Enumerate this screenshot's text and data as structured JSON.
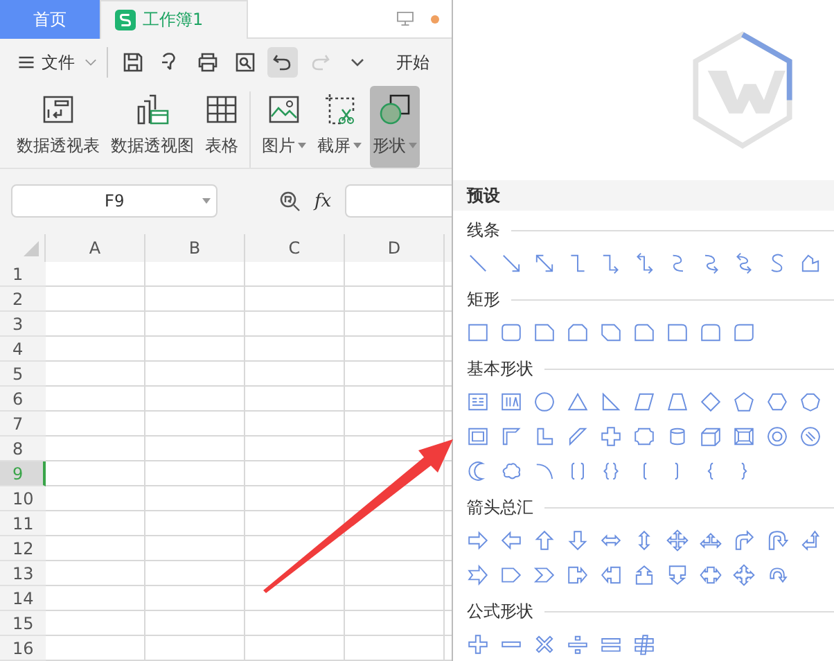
{
  "tabs": [
    {
      "label": "首页",
      "kind": "home",
      "selected": false
    },
    {
      "label": "工作簿1",
      "kind": "doc",
      "selected": true
    }
  ],
  "toolbar": {
    "file_menu": "文件",
    "start_tab": "开始"
  },
  "ribbon": [
    {
      "label": "数据透视表",
      "kind": "pivot-table",
      "dropdown": false,
      "active": false
    },
    {
      "label": "数据透视图",
      "kind": "pivot-chart",
      "dropdown": false,
      "active": false
    },
    {
      "label": "表格",
      "kind": "table",
      "dropdown": false,
      "active": false
    },
    {
      "label": "图片",
      "kind": "picture",
      "dropdown": true,
      "active": false
    },
    {
      "label": "截屏",
      "kind": "screenshot",
      "dropdown": true,
      "active": false
    },
    {
      "label": "形状",
      "kind": "shape",
      "dropdown": true,
      "active": true
    }
  ],
  "formula_bar": {
    "name_box": "F9",
    "fx": "fx"
  },
  "sheet": {
    "columns": [
      "A",
      "B",
      "C",
      "D"
    ],
    "rows": [
      {
        "label": "1",
        "selected": false
      },
      {
        "label": "2",
        "selected": false
      },
      {
        "label": "3",
        "selected": false
      },
      {
        "label": "4",
        "selected": false
      },
      {
        "label": "5",
        "selected": false
      },
      {
        "label": "6",
        "selected": false
      },
      {
        "label": "7",
        "selected": false
      },
      {
        "label": "8",
        "selected": false
      },
      {
        "label": "9",
        "selected": true
      },
      {
        "label": "10",
        "selected": false
      },
      {
        "label": "11",
        "selected": false
      },
      {
        "label": "12",
        "selected": false
      },
      {
        "label": "13",
        "selected": false
      },
      {
        "label": "14",
        "selected": false
      },
      {
        "label": "15",
        "selected": false
      },
      {
        "label": "16",
        "selected": false
      }
    ]
  },
  "shape_panel": {
    "header": "预设",
    "sections": [
      {
        "title": "线条",
        "kind": "lines"
      },
      {
        "title": "矩形",
        "kind": "rectangles"
      },
      {
        "title": "基本形状",
        "kind": "basic"
      },
      {
        "title": "箭头总汇",
        "kind": "arrows"
      },
      {
        "title": "公式形状",
        "kind": "formula"
      }
    ]
  }
}
